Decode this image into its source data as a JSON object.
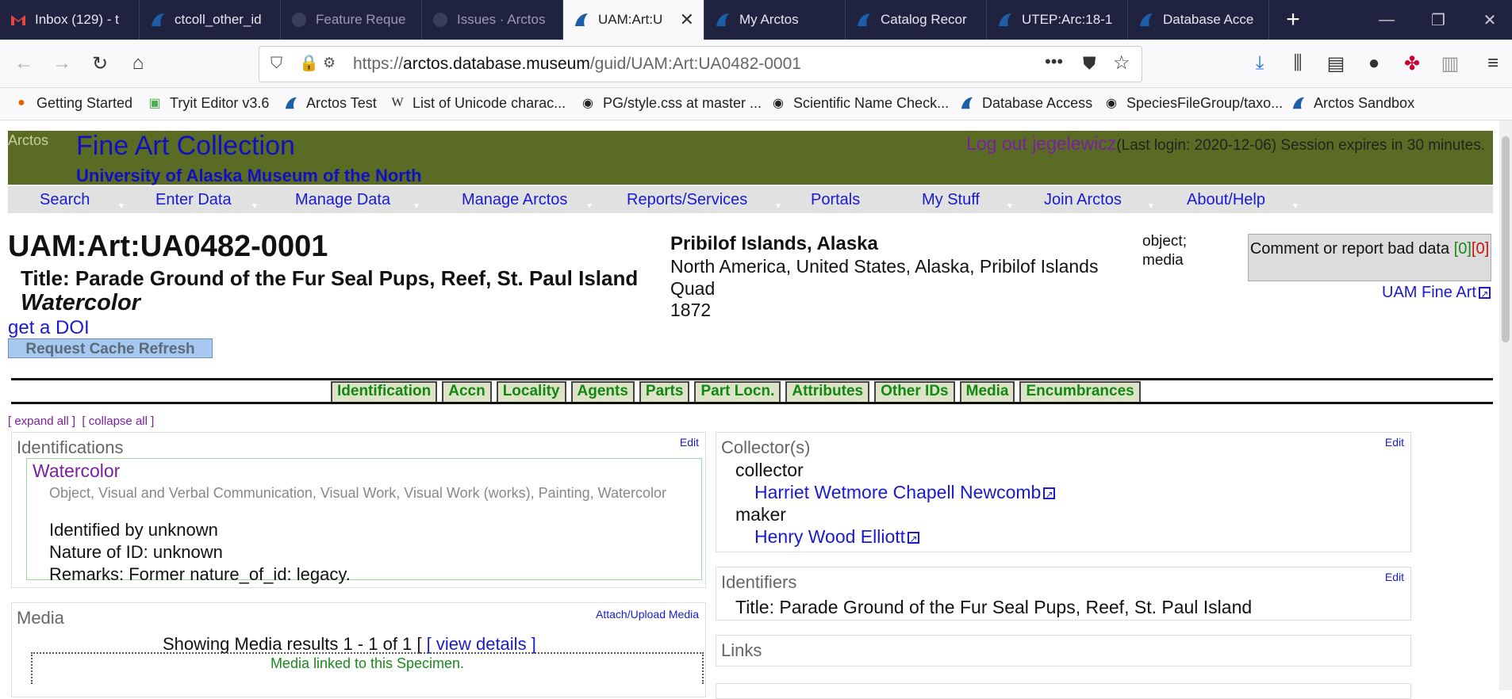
{
  "browser": {
    "tabs": [
      {
        "label": "Inbox (129) - t",
        "icon": "gmail-icon"
      },
      {
        "label": "ctcoll_other_id",
        "icon": "arctos-icon"
      },
      {
        "label": "Feature Reque",
        "icon": "github-icon"
      },
      {
        "label": "Issues · Arctos",
        "icon": "github-icon"
      },
      {
        "label": "UAM:Art:U",
        "icon": "arctos-icon",
        "active": true
      },
      {
        "label": "My Arctos",
        "icon": "arctos-icon"
      },
      {
        "label": "Catalog Recor",
        "icon": "arctos-icon"
      },
      {
        "label": "UTEP:Arc:18-1",
        "icon": "arctos-icon"
      },
      {
        "label": "Database Acce",
        "icon": "arctos-icon"
      }
    ],
    "new_tab": "+",
    "url_prefix": "https://",
    "url_domain": "arctos.database.museum",
    "url_path": "/guid/UAM:Art:UA0482-0001",
    "bookmarks": [
      {
        "label": "Getting Started",
        "icon": "firefox-icon"
      },
      {
        "label": "Tryit Editor v3.6",
        "icon": "w3schools-icon"
      },
      {
        "label": "Arctos Test",
        "icon": "arctos-icon"
      },
      {
        "label": "List of Unicode charac...",
        "icon": "wikipedia-icon"
      },
      {
        "label": "PG/style.css at master ...",
        "icon": "github-icon"
      },
      {
        "label": "Scientific Name Check...",
        "icon": "github-icon"
      },
      {
        "label": "Database Access",
        "icon": "arctos-icon"
      },
      {
        "label": "SpeciesFileGroup/taxo...",
        "icon": "github-icon"
      },
      {
        "label": "Arctos Sandbox",
        "icon": "arctos-icon"
      }
    ]
  },
  "header": {
    "arctos": "Arctos",
    "collection": "Fine Art Collection",
    "institution": "University of Alaska Museum of the North",
    "logout": "Log out jegelewicz",
    "login_info": "(Last login: 2020-12-06)  Session expires in 30 minutes."
  },
  "menu": [
    "Search",
    "Enter Data",
    "Manage Data",
    "Manage Arctos",
    "Reports/Services",
    "Portals",
    "My Stuff",
    "Join Arctos",
    "About/Help"
  ],
  "record": {
    "guid": "UAM:Art:UA0482-0001",
    "title": "Title: Parade Ground of the Fur Seal Pups, Reef, St. Paul Island",
    "medium": "Watercolor",
    "doi": "get a DOI",
    "cache_refresh": "Request Cache Refresh",
    "place_highlight": "Pribilof Islands, Alaska",
    "place_geography": "North America, United States, Alaska, Pribilof Islands Quad",
    "year": "1872",
    "object_type": "object;",
    "media_flag": "media",
    "comment_label": "Comment or report bad data",
    "comment_green": "[0]",
    "comment_red": "[0]",
    "collection_link": "UAM Fine Art"
  },
  "section_tabs": [
    "Identification",
    "Accn",
    "Locality",
    "Agents",
    "Parts",
    "Part Locn.",
    "Attributes",
    "Other IDs",
    "Media",
    "Encumbrances"
  ],
  "expand_all": "[ expand all ]",
  "collapse_all": "[ collapse all ]",
  "identifications": {
    "heading": "Identifications",
    "edit": "Edit",
    "name": "Watercolor",
    "taxonomy": "Object, Visual and Verbal Communication, Visual Work, Visual Work (works), Painting, Watercolor",
    "identified_by": "Identified by unknown",
    "nature": "Nature of ID: unknown",
    "remarks": "Remarks: Former nature_of_id: legacy."
  },
  "collectors": {
    "heading": "Collector(s)",
    "edit": "Edit",
    "role1": "collector",
    "agent1": "Harriet Wetmore Chapell Newcomb",
    "role2": "maker",
    "agent2": "Henry Wood Elliott"
  },
  "identifiers": {
    "heading": "Identifiers",
    "edit": "Edit",
    "value": "Title: Parade Ground of the Fur Seal Pups, Reef, St. Paul Island"
  },
  "links": {
    "heading": "Links"
  },
  "media": {
    "heading": "Media",
    "attach": "Attach/Upload Media",
    "showing": "Showing Media results 1 - 1 of 1 [",
    "view_details": "[ view details ]",
    "linked": "Media linked to this Specimen."
  }
}
